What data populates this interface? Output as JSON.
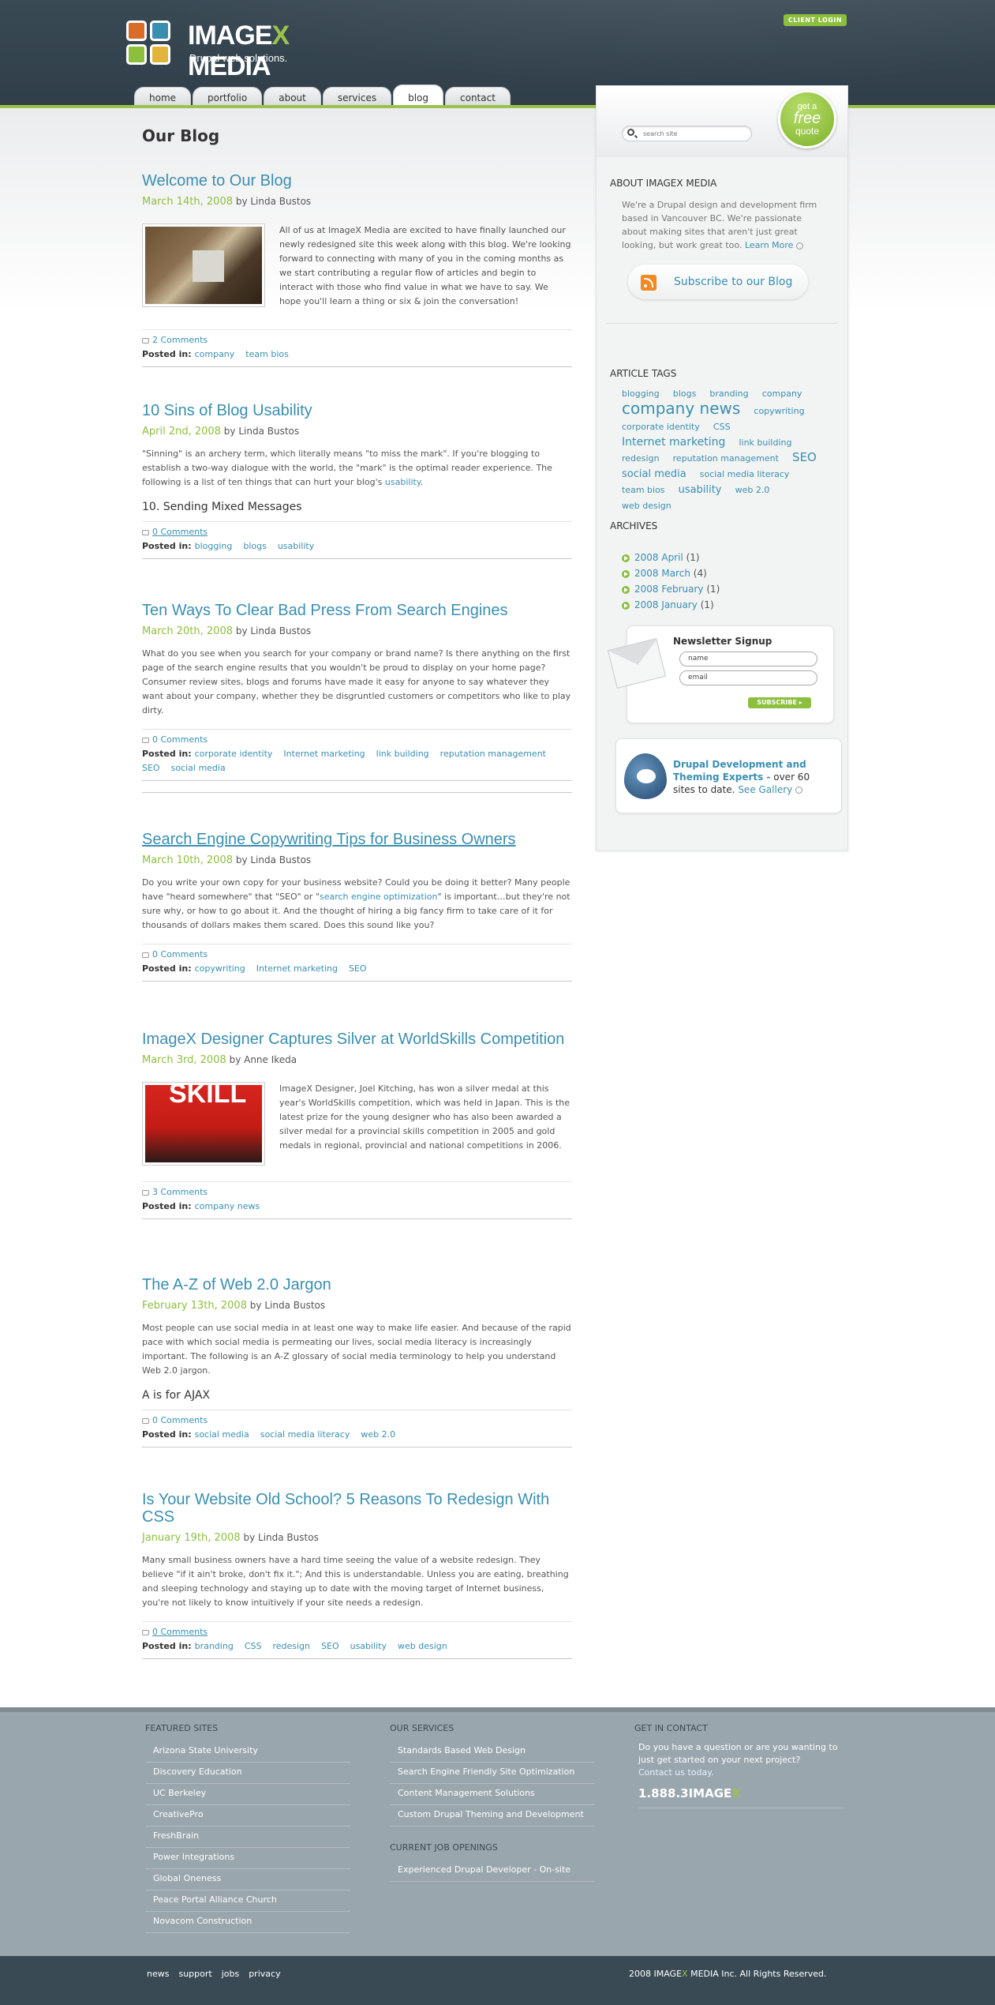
{
  "header": {
    "logo_name_pre": "IMAGE",
    "logo_name_x": "X",
    "logo_name_post": " MEDIA",
    "tagline": "Drupal web solutions.",
    "client_login": "CLIENT LOGIN",
    "nav": [
      {
        "label": "home"
      },
      {
        "label": "portfolio"
      },
      {
        "label": "about"
      },
      {
        "label": "services"
      },
      {
        "label": "blog",
        "active": true
      },
      {
        "label": "contact"
      }
    ]
  },
  "main": {
    "page_title": "Our Blog",
    "posts": [
      {
        "title": "Welcome to Our Blog",
        "date": "March 14th, 2008",
        "author": "by Linda Bustos",
        "body": "All of us at ImageX Media are excited to have finally launched our newly redesigned site this week along with this blog. We're looking forward to connecting with many of you in the coming months as we start contributing a regular flow of articles and begin to interact with those who find value in what we have to say. We hope you'll learn a thing or six & join the conversation!",
        "comments": "2 Comments",
        "posted_label": "Posted in:",
        "tags": [
          "company",
          "team bios"
        ]
      },
      {
        "title": "10 Sins of Blog Usability",
        "date": "April 2nd, 2008",
        "author": "by Linda Bustos",
        "body": "\"Sinning\" is an archery term, which literally means \"to miss the mark\". If you're blogging to establish a two-way dialogue with the world, the \"mark\" is the optimal reader experience. The following is a list of ten things that can hurt your blog's",
        "body_link": "usability",
        "body_end": ".",
        "subhead": "10. Sending Mixed Messages",
        "comments": "0 Comments",
        "posted_label": "Posted in:",
        "tags": [
          "blogging",
          "blogs",
          "usability"
        ]
      },
      {
        "title": "Ten Ways To Clear Bad Press From Search Engines",
        "date": "March 20th, 2008",
        "author": "by Linda Bustos",
        "body": "What do you see when you search for your company or brand name? Is there anything on the first page of the search engine results that you wouldn't be proud to display on your home page? Consumer review sites, blogs and forums have made it easy for anyone to say whatever they want about your company, whether they be disgruntled customers or competitors who like to play dirty.",
        "comments": "0 Comments",
        "posted_label": "Posted in:",
        "tags": [
          "corporate identity",
          "Internet marketing",
          "link building",
          "reputation management",
          "SEO",
          "social media"
        ]
      },
      {
        "title": "Search Engine Copywriting Tips for Business Owners",
        "date": "March 10th, 2008",
        "author": "by Linda Bustos",
        "body": "Do you write your own copy for your business website? Could you be doing it better? Many people have \"heard somewhere\" that \"SEO\" or",
        "body_link": "search engine optimization",
        "body_end": "\" is important…but they're not sure why, or how to go about it. And the thought of hiring a big fancy firm to take care of it for thousands of dollars makes them scared. Does this sound like you?",
        "comments": "0 Comments",
        "posted_label": "Posted in:",
        "tags": [
          "copywriting",
          "Internet marketing",
          "SEO"
        ]
      },
      {
        "title": "ImageX Designer Captures Silver at WorldSkills Competition",
        "date": "March 3rd, 2008",
        "author": "by Anne Ikeda",
        "body": "ImageX Designer, Joel Kitching, has won a silver medal at this year's WorldSkills competition, which was held in Japan. This is the latest prize for the young designer who has also been awarded a silver medal for a provincial skills competition in 2005 and gold medals in regional, provincial and national competitions in 2006.",
        "thumb_text": "SKILL",
        "comments": "3 Comments",
        "posted_label": "Posted in:",
        "tags": [
          "company news"
        ]
      },
      {
        "title": "The A-Z of Web 2.0 Jargon",
        "date": "February 13th, 2008",
        "author": "by Linda Bustos",
        "body": "Most people can use social media in at least one way to make life easier. And because of the rapid pace with which social media is permeating our lives, social media literacy is increasingly important. The following is an A-Z glossary of social media terminology to help you understand Web 2.0 jargon.",
        "subhead": "A is for AJAX",
        "comments": "0 Comments",
        "posted_label": "Posted in:",
        "tags": [
          "social media",
          "social media literacy",
          "web 2.0"
        ]
      },
      {
        "title": "Is Your Website Old School? 5 Reasons To Redesign With CSS",
        "date": "January 19th, 2008",
        "author": "by Linda Bustos",
        "body": "Many small business owners have a hard time seeing the value of a website redesign. They believe \"if it ain't broke, don't fix it.\"; And this is understandable. Unless you are eating, breathing and sleeping technology and staying up to date with the moving target of Internet business, you're not likely to know intuitively if your site needs a redesign.",
        "comments": "0 Comments",
        "posted_label": "Posted in:",
        "tags": [
          "branding",
          "CSS",
          "redesign",
          "SEO",
          "usability",
          "web design"
        ]
      }
    ]
  },
  "sidebar": {
    "search_placeholder": "search site",
    "quote_a": "get a",
    "quote_b": "free",
    "quote_c": "quote",
    "about_heading": "ABOUT IMAGEX MEDIA",
    "about_text": "We're a Drupal design and development firm based in Vancouver BC. We're passionate about making sites that aren't just great looking, but work great too.",
    "learn_more": "Learn More",
    "subscribe": "Subscribe to our Blog",
    "tags_heading": "ARTICLE TAGS",
    "tags": [
      {
        "t": "blogging",
        "s": 11
      },
      {
        "t": "blogs",
        "s": 11
      },
      {
        "t": "branding",
        "s": 11
      },
      {
        "t": "company",
        "s": 11
      },
      {
        "t": "company news",
        "s": 20
      },
      {
        "t": "copywriting",
        "s": 11
      },
      {
        "t": "corporate identity",
        "s": 11
      },
      {
        "t": "CSS",
        "s": 11
      },
      {
        "t": "Internet marketing",
        "s": 14
      },
      {
        "t": "link building",
        "s": 11
      },
      {
        "t": "redesign",
        "s": 11
      },
      {
        "t": "reputation management",
        "s": 11
      },
      {
        "t": "SEO",
        "s": 15
      },
      {
        "t": "social media",
        "s": 13
      },
      {
        "t": "social media literacy",
        "s": 11
      },
      {
        "t": "team bios",
        "s": 11
      },
      {
        "t": "usability",
        "s": 13
      },
      {
        "t": "web 2.0",
        "s": 11
      },
      {
        "t": "web design",
        "s": 11
      }
    ],
    "archives_heading": "ARCHIVES",
    "archives": [
      {
        "label": "2008 April",
        "count": "(1)"
      },
      {
        "label": "2008 March",
        "count": "(4)"
      },
      {
        "label": "2008 February",
        "count": "(1)"
      },
      {
        "label": "2008 January",
        "count": "(1)"
      }
    ],
    "newsletter_title": "Newsletter Signup",
    "nl_name": "name",
    "nl_email": "email",
    "nl_subscribe": "SUBSCRIBE",
    "drupal_bold": "Drupal Development and Theming Experts -",
    "drupal_rest": " over 60 sites to date.",
    "see_gallery": "See Gallery"
  },
  "footer": {
    "featured_heading": "FEATURED SITES",
    "featured": [
      "Arizona State University",
      "Discovery Education",
      "UC Berkeley",
      "CreativePro",
      "FreshBrain",
      "Power Integrations",
      "Global Oneness",
      "Peace Portal Alliance Church",
      "Novacom Construction"
    ],
    "services_heading": "OUR SERVICES",
    "services": [
      "Standards Based Web Design",
      "Search Engine Friendly Site Optimization",
      "Content Management Solutions",
      "Custom Drupal Theming and Development"
    ],
    "jobs_heading": "CURRENT JOB OPENINGS",
    "jobs": [
      "Experienced Drupal Developer - On-site"
    ],
    "contact_heading": "GET IN CONTACT",
    "contact_text": "Do you have a question or are you wanting to just get started on your next project?",
    "contact_link": "Contact us today.",
    "phone_pre": "1.888.3IMAGE",
    "phone_x": "X",
    "bottom_links": [
      "news",
      "support",
      "jobs",
      "privacy"
    ],
    "copyright_pre": "2008 IMAGE",
    "copyright_x": "X",
    "copyright_post": " MEDIA Inc. All Rights Reserved."
  },
  "colors": {
    "brand_green": "#8dbf3e",
    "link_blue": "#3a8fb0",
    "header_dark": "#34444f",
    "footer_gray": "#9aa6ae"
  }
}
